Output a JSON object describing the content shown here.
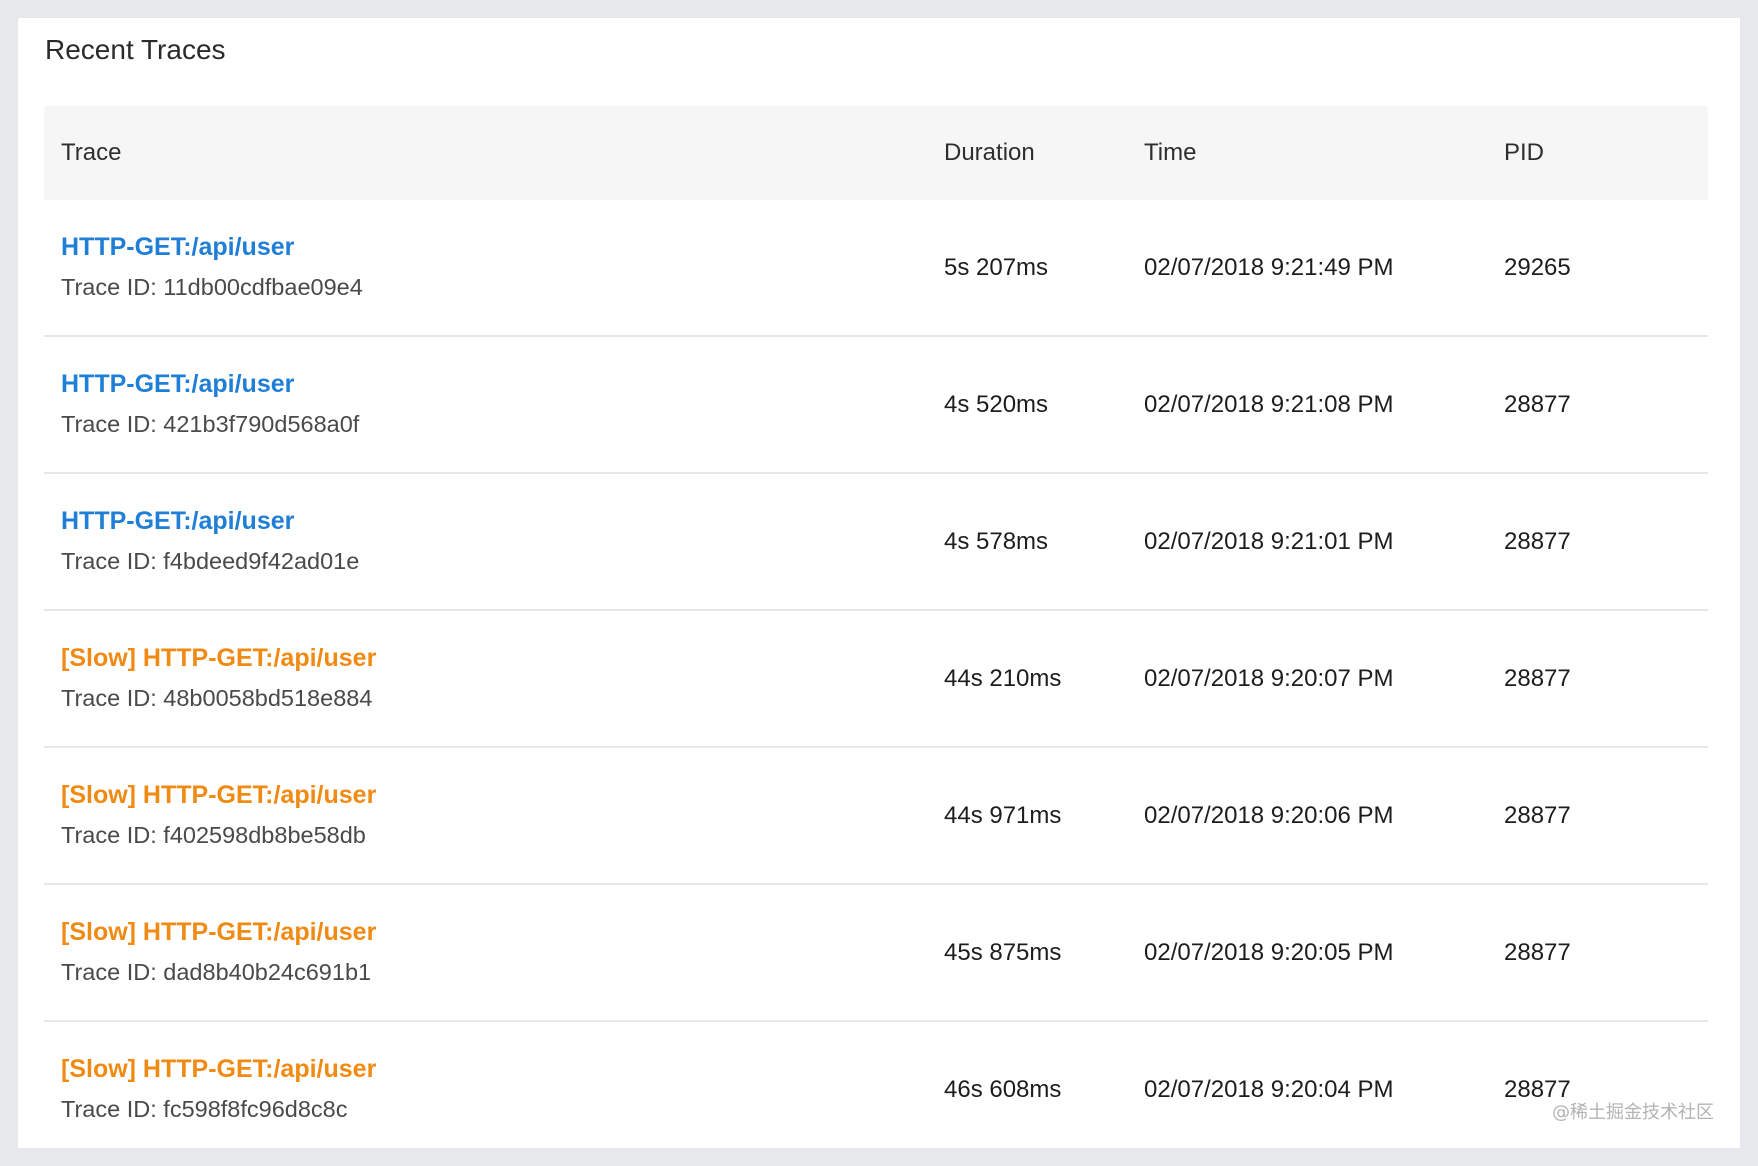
{
  "panel": {
    "title": "Recent Traces"
  },
  "table": {
    "headers": {
      "trace": "Trace",
      "duration": "Duration",
      "time": "Time",
      "pid": "PID"
    },
    "trace_id_prefix": "Trace ID: ",
    "rows": [
      {
        "name": "HTTP-GET:/api/user",
        "slow": false,
        "trace_id": "Trace ID: 11db00cdfbae09e4",
        "duration": "5s 207ms",
        "time": "02/07/2018 9:21:49 PM",
        "pid": "29265"
      },
      {
        "name": "HTTP-GET:/api/user",
        "slow": false,
        "trace_id": "Trace ID: 421b3f790d568a0f",
        "duration": "4s 520ms",
        "time": "02/07/2018 9:21:08 PM",
        "pid": "28877"
      },
      {
        "name": "HTTP-GET:/api/user",
        "slow": false,
        "trace_id": "Trace ID: f4bdeed9f42ad01e",
        "duration": "4s 578ms",
        "time": "02/07/2018 9:21:01 PM",
        "pid": "28877"
      },
      {
        "name": "[Slow] HTTP-GET:/api/user",
        "slow": true,
        "trace_id": "Trace ID: 48b0058bd518e884",
        "duration": "44s 210ms",
        "time": "02/07/2018 9:20:07 PM",
        "pid": "28877"
      },
      {
        "name": "[Slow] HTTP-GET:/api/user",
        "slow": true,
        "trace_id": "Trace ID: f402598db8be58db",
        "duration": "44s 971ms",
        "time": "02/07/2018 9:20:06 PM",
        "pid": "28877"
      },
      {
        "name": "[Slow] HTTP-GET:/api/user",
        "slow": true,
        "trace_id": "Trace ID: dad8b40b24c691b1",
        "duration": "45s 875ms",
        "time": "02/07/2018 9:20:05 PM",
        "pid": "28877"
      },
      {
        "name": "[Slow] HTTP-GET:/api/user",
        "slow": true,
        "trace_id": "Trace ID: fc598f8fc96d8c8c",
        "duration": "46s 608ms",
        "time": "02/07/2018 9:20:04 PM",
        "pid": "28877"
      }
    ]
  },
  "colors": {
    "normal_link": "#1f7ed6",
    "slow_link": "#f08a12"
  },
  "watermark": "@稀土掘金技术社区"
}
